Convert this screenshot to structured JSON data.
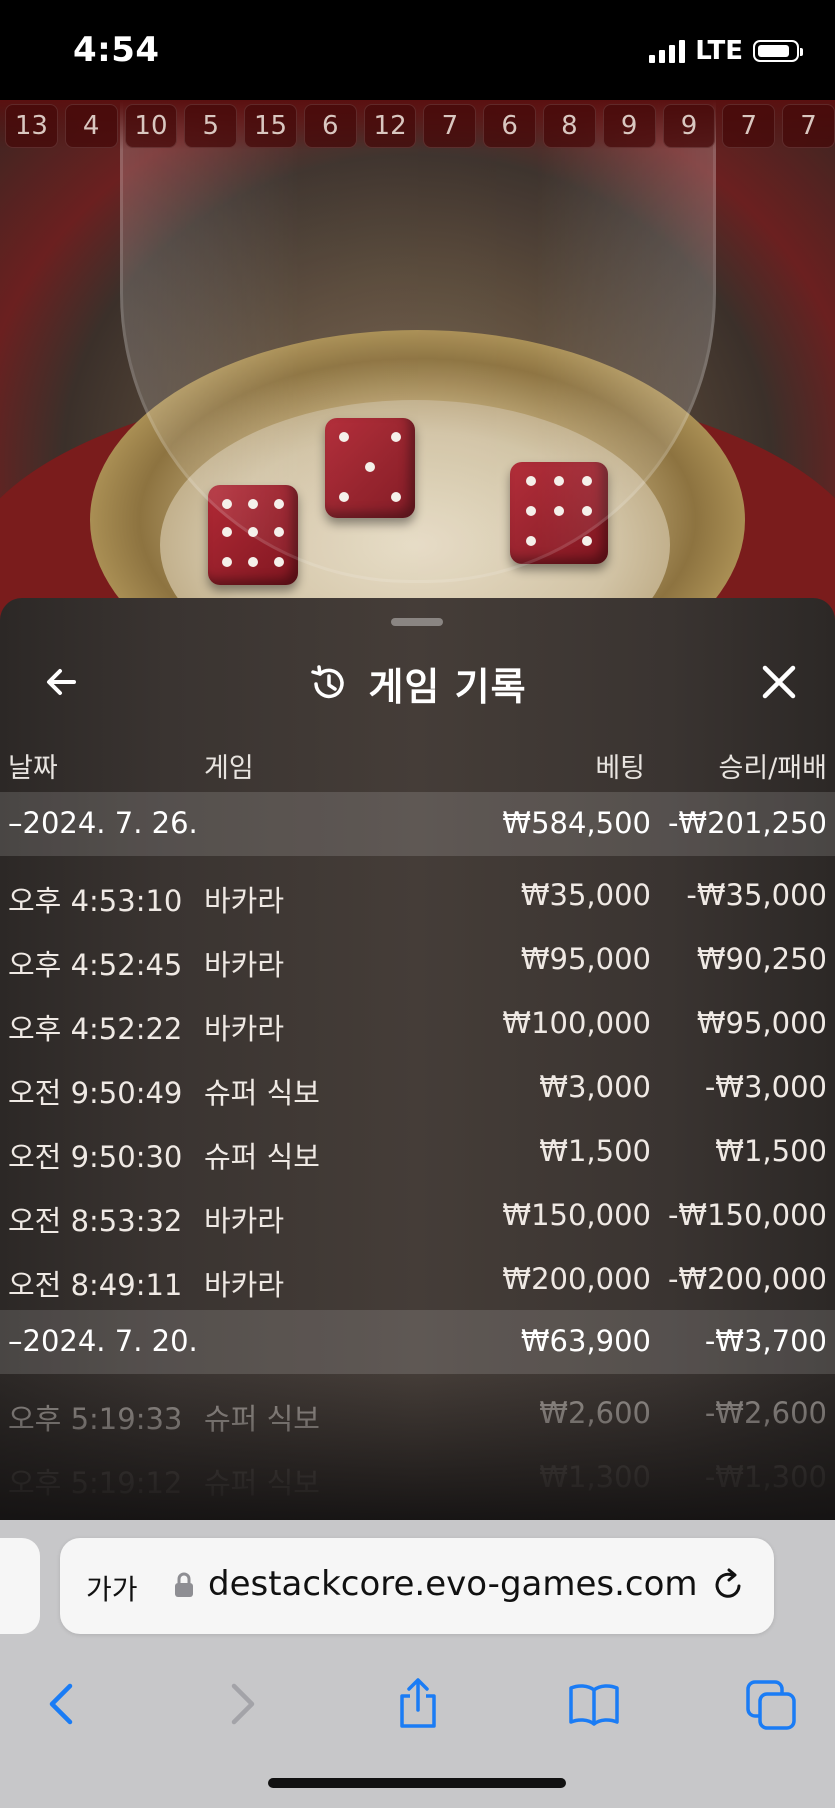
{
  "status_bar": {
    "time": "4:54",
    "network": "LTE"
  },
  "roadmap": [
    "13",
    "4",
    "10",
    "5",
    "15",
    "6",
    "12",
    "7",
    "6",
    "8",
    "9",
    "9",
    "7",
    "7"
  ],
  "panel": {
    "title": "게임 기록",
    "columns": {
      "date": "날짜",
      "game": "게임",
      "bet": "베팅",
      "result": "승리/패배"
    },
    "groups": [
      {
        "date": "–2024. 7. 26.",
        "bet": "₩584,500",
        "result": "-₩201,250",
        "entries": [
          {
            "time": "오후 4:53:10",
            "game": "바카라",
            "bet": "₩35,000",
            "result": "-₩35,000"
          },
          {
            "time": "오후 4:52:45",
            "game": "바카라",
            "bet": "₩95,000",
            "result": "₩90,250"
          },
          {
            "time": "오후 4:52:22",
            "game": "바카라",
            "bet": "₩100,000",
            "result": "₩95,000"
          },
          {
            "time": "오전 9:50:49",
            "game": "슈퍼 식보",
            "bet": "₩3,000",
            "result": "-₩3,000"
          },
          {
            "time": "오전 9:50:30",
            "game": "슈퍼 식보",
            "bet": "₩1,500",
            "result": "₩1,500"
          },
          {
            "time": "오전 8:53:32",
            "game": "바카라",
            "bet": "₩150,000",
            "result": "-₩150,000"
          },
          {
            "time": "오전 8:49:11",
            "game": "바카라",
            "bet": "₩200,000",
            "result": "-₩200,000"
          }
        ]
      },
      {
        "date": "–2024. 7. 20.",
        "bet": "₩63,900",
        "result": "-₩3,700",
        "entries": [
          {
            "time": "오후 5:19:33",
            "game": "슈퍼 식보",
            "bet": "₩2,600",
            "result": "-₩2,600"
          },
          {
            "time": "오후 5:19:12",
            "game": "슈퍼 식보",
            "bet": "₩1,300",
            "result": "-₩1,300"
          }
        ]
      }
    ]
  },
  "safari": {
    "text_size_label": "가가",
    "url": "destackcore.evo-games.com"
  },
  "colors": {
    "safari_blue": "#1a7cf5",
    "panel_bg": "#3a3431"
  }
}
